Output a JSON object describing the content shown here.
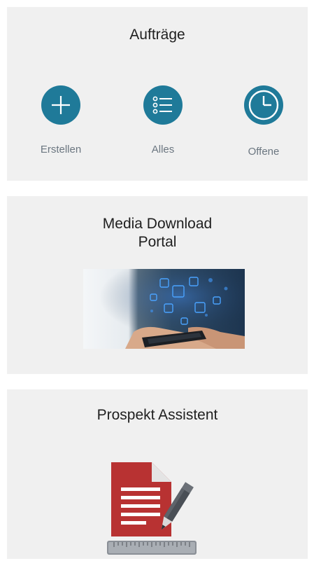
{
  "auftraege": {
    "title": "Aufträge",
    "actions": [
      {
        "label": "Erstellen",
        "icon": "plus-icon"
      },
      {
        "label": "Alles",
        "icon": "list-icon"
      },
      {
        "label": "Offene",
        "icon": "clock-icon"
      }
    ]
  },
  "media": {
    "title_line1": "Media Download",
    "title_line2": "Portal",
    "image": "hand-holding-phone-with-floating-media-icons"
  },
  "prospekt": {
    "title": "Prospekt Assistent",
    "image": "document-pencil-ruler-icon"
  },
  "colors": {
    "accent": "#1f7a99",
    "card_background": "#f0f0f0",
    "document_red": "#b83232",
    "label_gray": "#6b7680"
  }
}
